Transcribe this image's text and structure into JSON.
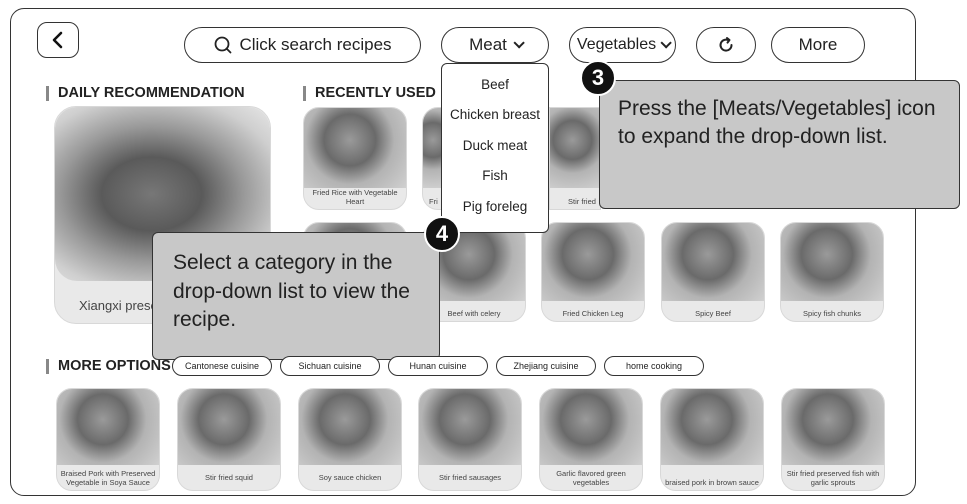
{
  "toolbar": {
    "search_label": "Click search recipes",
    "meat_label": "Meat",
    "vegetables_label": "Vegetables",
    "more_label": "More"
  },
  "sections": {
    "daily": "DAILY RECOMMENDATION",
    "recent": "RECENTLY USED",
    "more_options": "MORE OPTIONS"
  },
  "daily_card": {
    "caption": "Xiangxi prese"
  },
  "recent_row1": [
    {
      "caption": "Fried Rice with Vegetable Heart"
    },
    {
      "caption": "Fri"
    },
    {
      "caption": "Stir fried"
    }
  ],
  "recent_row2": [
    {
      "caption": "Beef with celery"
    },
    {
      "caption": "Fried Chicken Leg"
    },
    {
      "caption": "Spicy Beef"
    },
    {
      "caption": "Spicy fish chunks"
    }
  ],
  "dropdown": {
    "items": [
      "Beef",
      "Chicken breast",
      "Duck meat",
      "Fish",
      "Pig foreleg"
    ]
  },
  "tooltips": {
    "step3_num": "3",
    "step3_text": "Press the [Meats/Vegetables] icon to expand the drop-down list.",
    "step4_num": "4",
    "step4_text": "Select a category in the drop-down list to view the recipe."
  },
  "cuisines": [
    "Cantonese cuisine",
    "Sichuan cuisine",
    "Hunan cuisine",
    "Zhejiang cuisine",
    "home cooking"
  ],
  "more_cards": [
    {
      "caption": "Braised Pork with Preserved Vegetable in Soya Sauce"
    },
    {
      "caption": "Stir fried squid"
    },
    {
      "caption": "Soy sauce chicken"
    },
    {
      "caption": "Stir fried sausages"
    },
    {
      "caption": "Garlic flavored green vegetables"
    },
    {
      "caption": "braised pork in brown sauce"
    },
    {
      "caption": "Stir fried preserved fish with garlic sprouts"
    }
  ],
  "icons": {
    "back": "chevron-left-icon",
    "search": "search-icon",
    "refresh": "refresh-icon",
    "dropdown": "chevron-down-icon"
  }
}
